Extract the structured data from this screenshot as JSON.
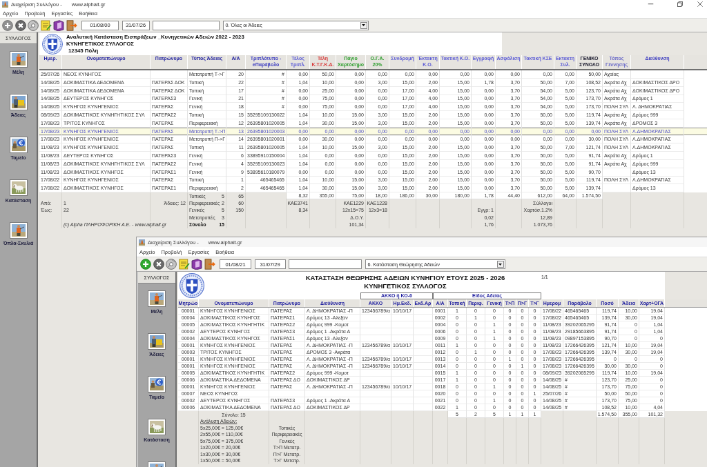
{
  "windows": [
    {
      "title": "Διαχείριση Συλλόγου -",
      "url": "www.alphait.gr",
      "menu": [
        "Αρχείο",
        "Προβολή",
        "Εργασίες",
        "Βοήθεια"
      ],
      "toolbar": {
        "buttons": [
          {
            "kind": "add",
            "disabled": true
          },
          {
            "kind": "delete",
            "disabled": true
          },
          {
            "kind": "disc",
            "disabled": false
          },
          {
            "kind": "notes",
            "disabled": false
          },
          {
            "kind": "book",
            "disabled": false
          },
          {
            "kind": "exit",
            "disabled": false
          }
        ],
        "date_from": "01/08/00",
        "date_to": "31/07/26",
        "report_choice": "0. Όλες οι Άδειες"
      },
      "sidebar": {
        "title": "ΣΥΛΛΟΓΟΣ",
        "items": [
          {
            "kind": "person",
            "label": "Μέλη"
          },
          {
            "kind": "bag",
            "label": "Άδειες"
          },
          {
            "kind": "euro",
            "label": "Ταμείο"
          },
          {
            "kind": "dog",
            "label": "Κατάσταση"
          },
          {
            "kind": "person",
            "label": "Όπλα-Σκυλιά"
          }
        ]
      },
      "report": {
        "kind": "income",
        "title": "Αναλυτική Κατάσταση Εισπράξεων _Κυνηγετικών Αδειών 2022 - 2023",
        "organization": "ΚΥΝΗΓΕΤΙΚΟΣ ΣΥΛΛΟΓΟΣ",
        "city": "12345 Πόλη",
        "columns": [
          {
            "label": "Ημερ.",
            "color": "#1f1f9f"
          },
          {
            "label": "Ονοματεπώνυμο",
            "color": "#1f1f9f"
          },
          {
            "label": "Πατρώνυμο",
            "color": "#1f1f9f"
          },
          {
            "label": "Τύπος Άδειας",
            "color": "#1f1f9f"
          },
          {
            "label": "Α/Α",
            "color": "#1f1f9f"
          },
          {
            "label": "Τριπλότυπο -\neΠαράβολο",
            "color": "#3c3cc0"
          },
          {
            "label": "Τέλος\nΤριπλ.",
            "color": "#5c5cd6"
          },
          {
            "label": "Τέλη\nΚ.Τ.Γ.Κ.Δ.",
            "color": "#d83c3c"
          },
          {
            "label": "Πάγιο\nΧαρτόσημο",
            "color": "#2e9e2e"
          },
          {
            "label": "Ο.Γ.Α.\n20%",
            "color": "#2e9e2e"
          },
          {
            "label": "Συνδρομή",
            "color": "#5c5cd6"
          },
          {
            "label": "Έκτακτη\nΚ.Ο.",
            "color": "#5c5cd6"
          },
          {
            "label": "Τακτική Κ.Ο.",
            "color": "#5c5cd6"
          },
          {
            "label": "Εγγραφή",
            "color": "#5c5cd6"
          },
          {
            "label": "Ασφάλιση",
            "color": "#5c5cd6"
          },
          {
            "label": "Τακτική ΚΣΕ",
            "color": "#5c5cd6"
          },
          {
            "label": "Εκτακτη\nΣυλ.",
            "color": "#5c5cd6"
          },
          {
            "label": "ΓΕΝΙΚΟ\nΣΥΝΟΛΟ",
            "color": "#141428"
          },
          {
            "label": "Τόπος\nΓέννησης",
            "color": "#6a6ac8"
          },
          {
            "label": "Διεύθυνση",
            "color": "#3c3cc0"
          }
        ],
        "rows": [
          {
            "selected": false,
            "cells": [
              "25/07/26",
              "ΝΕΟΣ ΚΥΝΗΓΟΣ",
              null,
              "Μετατροπή Τ->Γ",
              "20",
              "#",
              "0,00",
              "50,00",
              "0,00",
              "0,00",
              "0,00",
              "0,00",
              "0,00",
              "0,00",
              "0,00",
              "0,00",
              "0,00",
              "50,00",
              "Αχαίας",
              null
            ]
          },
          {
            "selected": false,
            "cells": [
              "14/08/25",
              "ΔΟΚΙΜΑΣΤΙΚΑ ΔΕΔΟΜΕΝΑ",
              "ΠΑΤΕΡΑΣ ΔΟΚ",
              "Τοπική",
              "22",
              "#",
              "1,04",
              "10,00",
              "0,00",
              "3,00",
              "15,00",
              "2,00",
              "15,00",
              "1,78",
              "3,70",
              "50,00",
              "7,00",
              "108,52",
              "Ακράτα Αχ",
              "ΔΟΚΙΜΑΣΤΙΚΟΣ ΔΡΟ"
            ]
          },
          {
            "selected": false,
            "cells": [
              "14/08/25",
              "ΔΟΚΙΜΑΣΤΙΚΑ ΔΕΔΟΜΕΝΑ",
              "ΠΑΤΕΡΑΣ ΔΟΚ",
              "Τοπική",
              "17",
              "#",
              "0,00",
              "25,00",
              "0,00",
              "0,00",
              "17,00",
              "4,00",
              "15,00",
              "0,00",
              "3,70",
              "54,00",
              "5,00",
              "123,70",
              "Ακράτα Αχ",
              "ΔΟΚΙΜΑΣΤΙΚΟΣ ΔΡΟ"
            ]
          },
          {
            "selected": false,
            "cells": [
              "14/08/25",
              "ΔΕΥΤΕΡΟΣ ΚΥΝΗΓΟΣ",
              "ΠΑΤΕΡΑΣ3",
              "Γενική",
              "21",
              "#",
              "0,00",
              "75,00",
              "0,00",
              "0,00",
              "17,00",
              "4,00",
              "15,00",
              "0,00",
              "3,70",
              "54,00",
              "5,00",
              "173,70",
              "Ακράτα Αχ",
              "Δρόμος 1"
            ]
          },
          {
            "selected": false,
            "cells": [
              "14/08/25",
              "ΚΥΝΗΓΟΣ ΚΥΝΗΓΕΝΙΟΣ",
              "ΠΑΤΕΡΑΣ",
              "Γενική",
              "18",
              "#",
              "0,00",
              "75,00",
              "0,00",
              "0,00",
              "17,00",
              "4,00",
              "15,00",
              "0,00",
              "3,70",
              "54,00",
              "5,00",
              "173,70",
              "ΠΟΛΗ ΣΥΛ",
              "Λ. ΔΗΜΟΚΡΑΤΙΑΣ"
            ]
          },
          {
            "selected": false,
            "cells": [
              "08/09/23",
              "ΔΟΚΙΜΑΣΤΙΚΟΣ ΚΥΝΗΓΗΤΙΚΟΣ ΣΥΛ",
              "ΠΑΤΕΡΑΣ2",
              "Τοπική",
              "15",
              "35295109130022",
              "1,04",
              "10,00",
              "15,00",
              "3,00",
              "15,00",
              "2,00",
              "15,00",
              "0,00",
              "3,70",
              "50,00",
              "5,00",
              "119,74",
              "Ακράτα Αχ",
              "Δρόμος 999"
            ]
          },
          {
            "selected": false,
            "cells": [
              "17/08/23",
              "ΤΡΙΤΟΣ ΚΥΝΗΓΟΣ",
              "ΠΑΤΕΡΑΣ",
              "Περιφερειακή",
              "12",
              "26395801020005",
              "1,04",
              "30,00",
              "15,00",
              "3,00",
              "15,00",
              "2,00",
              "15,00",
              "0,00",
              "3,70",
              "50,00",
              "5,00",
              "139,74",
              "Ακράτα Αχ",
              "ΔΡΟΜΟΣ 3"
            ]
          },
          {
            "selected": true,
            "cells": [
              "17/08/23",
              "ΚΥΝΗΓΟΣ ΚΥΝΗΓΕΝΙΟΣ",
              "ΠΑΤΕΡΑΣ",
              "Μετατροπή Τ->Π",
              "13",
              "26395801020003",
              "0,00",
              "0,00",
              "0,00",
              "0,00",
              "0,00",
              "0,00",
              "0,00",
              "0,00",
              "0,00",
              "0,00",
              "0,00",
              "0,00",
              "ΠΟΛΗ ΣΥΛ",
              "Λ.ΔΗΜΟΚΡΑΤΙΑΣ"
            ]
          },
          {
            "selected": false,
            "cells": [
              "17/08/23",
              "ΚΥΝΗΓΟΣ ΚΥΝΗΓΕΝΙΟΣ",
              "ΠΑΤΕΡΑΣ",
              "Μετατροπή Π->Γ",
              "14",
              "26395801020001",
              "0,00",
              "30,00",
              "0,00",
              "0,00",
              "0,00",
              "0,00",
              "0,00",
              "0,00",
              "0,00",
              "0,00",
              "0,00",
              "30,00",
              "ΠΟΛΗ ΣΥΛ",
              "Λ.ΔΗΜΟΚΡΑΤΙΑΣ"
            ]
          },
          {
            "selected": false,
            "cells": [
              "11/08/23",
              "ΚΥΝΗΓΟΣ ΚΥΝΗΓΕΝΙΟΣ",
              "ΠΑΤΕΡΑΣ",
              "Τοπική",
              "11",
              "26395801020005",
              "1,04",
              "10,00",
              "15,00",
              "3,00",
              "15,00",
              "2,00",
              "15,00",
              "0,00",
              "3,70",
              "50,00",
              "7,00",
              "121,74",
              "ΠΟΛΗ ΣΥΛ",
              "Λ.ΔΗΜΟΚΡΑΤΙΑΣ"
            ]
          },
          {
            "selected": false,
            "cells": [
              "11/08/23",
              "ΔΕΥΤΕΡΟΣ ΚΥΝΗΓΟΣ",
              "ΠΑΤΕΡΑΣ3",
              "Γενική",
              "6",
              "33895910150004",
              "1,04",
              "0,00",
              "0,00",
              "0,00",
              "15,00",
              "2,00",
              "15,00",
              "0,00",
              "3,70",
              "50,00",
              "5,00",
              "91,74",
              "Ακράτα Αχ",
              "Δρόμος 1"
            ]
          },
          {
            "selected": false,
            "cells": [
              "11/08/23",
              "ΔΟΚΙΜΑΣΤΙΚΟΣ ΚΥΝΗΓΗΤΙΚΟΣ ΣΥΛ",
              "ΠΑΤΕΡΑΣ2",
              "Γενική",
              "4",
              "35295109130023",
              "1,04",
              "0,00",
              "0,00",
              "0,00",
              "15,00",
              "2,00",
              "15,00",
              "0,00",
              "3,70",
              "50,00",
              "5,00",
              "91,74",
              "Ακράτα Αχ",
              "Δρόμος 999"
            ]
          },
          {
            "selected": false,
            "cells": [
              "11/08/23",
              "ΔΟΚΙΜΑΣΤΙΚΟΣ ΚΥΝΗΓΟΣ",
              "ΠΑΤΕΡΑΣ1",
              "Γενική",
              "9",
              "53895610180079",
              "0,00",
              "0,00",
              "0,00",
              "0,00",
              "15,00",
              "2,00",
              "15,00",
              "0,00",
              "3,70",
              "50,00",
              "5,00",
              "90,70",
              null,
              "Δρόμος 13"
            ]
          },
          {
            "selected": false,
            "cells": [
              "17/08/22",
              "ΚΥΝΗΓΟΣ ΚΥΝΗΓΕΝΙΟΣ",
              "ΠΑΤΕΡΑΣ",
              "Τοπική",
              "1",
              "465465465",
              "1,04",
              "10,00",
              "15,00",
              "3,00",
              "15,00",
              "2,00",
              "15,00",
              "0,00",
              "3,70",
              "50,00",
              "5,00",
              "119,74",
              "ΠΟΛΗ ΣΥΛ",
              "Λ.ΔΗΜΟΚΡΑΤΙΑΣ"
            ]
          },
          {
            "selected": false,
            "cells": [
              "17/08/22",
              "ΔΟΚΙΜΑΣΤΙΚΟΣ ΚΥΝΗΓΟΣ",
              "ΠΑΤΕΡΑΣ1",
              "Περιφερειακή",
              "2",
              "465465465",
              "1,04",
              "30,00",
              "15,00",
              "3,00",
              "15,00",
              "2,00",
              "15,00",
              "0,00",
              "3,70",
              "50,00",
              "5,00",
              "139,74",
              null,
              "Δρόμος 13"
            ]
          }
        ],
        "totals": {
          "cells": [
            null,
            null,
            null,
            null,
            null,
            null,
            "8,32",
            "355,00",
            "75,00",
            "18,00",
            "186,00",
            "30,00",
            "180,00",
            "1,78",
            "44,40",
            "612,00",
            "64,00",
            "1.574,50",
            null,
            null
          ]
        },
        "footer_columns": [
          [
            null,
            "Από:",
            "Έως:"
          ],
          [
            null,
            "1",
            "22"
          ],
          [
            null,
            "Άδειες: 12"
          ],
          [
            {
              "label": "Τοπικές",
              "value": "5",
              "kind": "count"
            },
            {
              "label": "Περιφερειακές",
              "value": "2",
              "kind": "count"
            },
            {
              "label": "Γενικές",
              "value": "5",
              "kind": "count"
            },
            {
              "label": "Μετατροπές",
              "value": "3",
              "kind": "count"
            },
            {
              "label": "Σύνολο",
              "value": "15",
              "kind": "total"
            }
          ],
          [
            "65",
            "60",
            "150"
          ],
          null,
          [
            null,
            "ΚΑΕ3741",
            "8,34"
          ],
          null,
          [
            null,
            "ΚΑΕ1229",
            "12x15=75",
            "Δ.Ο.Υ.",
            "101,34"
          ],
          [
            null,
            "ΚΑΕ1228",
            "12x3=18"
          ],
          null,
          null,
          null,
          [
            null,
            null,
            "Εγγρ: 1",
            "0,02",
            "1,76"
          ],
          null,
          [
            null,
            "Σύλλογοι",
            "Χαρτόσ.1.2%",
            "12,89",
            "1.073,76"
          ],
          null,
          null,
          null,
          null
        ],
        "copyright": "(c) Alpha ΠΛΗΡΟΦΟΡΙΚΗ Α.Ε. - www.alphait.gr"
      }
    },
    {
      "title": "Διαχείριση Συλλόγου -",
      "url": "www.alphait.gr",
      "menu": [
        "Αρχείο",
        "Προβολή",
        "Εργασίες",
        "Βοήθεια"
      ],
      "toolbar": {
        "buttons": [
          {
            "kind": "add",
            "disabled": false
          },
          {
            "kind": "delete",
            "disabled": true
          },
          {
            "kind": "disc",
            "disabled": false
          },
          {
            "kind": "notes",
            "disabled": false
          },
          {
            "kind": "book",
            "disabled": false
          },
          {
            "kind": "exit",
            "disabled": false
          }
        ],
        "date_from": "01/08/21",
        "date_to": "31/07/29",
        "report_choice": "6. Κατάσταση Θεώρησης Αδειών"
      },
      "sidebar": {
        "title": "ΣΥΛΛΟΓΟΣ",
        "items": [
          {
            "kind": "person",
            "label": "Μέλη"
          },
          {
            "kind": "bag",
            "label": "Άδειες"
          },
          {
            "kind": "euro",
            "label": "Ταμείο"
          },
          {
            "kind": "dog",
            "label": "Κατάσταση"
          },
          {
            "kind": "person"
          }
        ]
      },
      "report": {
        "kind": "renewal",
        "title": "ΚΑΤΑΣΤΑΣΗ ΘΕΩΡΗΣΗΣ ΑΔΕΙΩΝ ΚΥΝΗΓΙΟΥ ΕΤΟΥΣ 2025 - 2026",
        "organization": "ΚΥΝΗΓΕΤΙΚΟΣ ΣΥΛΛΟΓΟΣ",
        "page": "1/1",
        "groups": [
          "ΑΚΚΟ ή ΚΟ-6",
          "Είδος Αδείας"
        ],
        "columns": [
          "Μητρώο",
          "Ονοματεπώνυμο",
          "Πατρώνυμο",
          "Διεύθυνση",
          "ΑΚΚΟ",
          "Ημ.Εκδ.",
          "Εκδ.Αρ",
          "Α/Α",
          "Τοπική",
          "Περιφ.",
          "Γενική",
          "Τ>Π",
          "Π>Γ",
          "Τ>Γ",
          "Ημερομ",
          "Παράβολο",
          "Ποσό",
          "Άδεια",
          "Χαρτ+ΟΓΑ"
        ],
        "rows": [
          [
            "00001",
            "ΚΥΝΗΓΟΣ ΚΥΝΗΓΕΝΙΟΣ",
            "ΠΑΤΕΡΑΣ",
            "Λ. ΔΗΜΟΚΡΑΤΙΑΣ -Π",
            "123456789/α",
            "10/10/17",
            null,
            "0001",
            "1",
            "0",
            "0",
            "0",
            "0",
            "0",
            "17/08/22",
            "465465465",
            "119,74",
            "10,00",
            "19,04"
          ],
          [
            "00004",
            "ΔΟΚΙΜΑΣΤΙΚΟΣ ΚΥΝΗΓΟΣ",
            "ΠΑΤΕΡΑΣ1",
            "Δρόμος 13 -Αλεξαν",
            null,
            null,
            null,
            "0002",
            "0",
            "1",
            "0",
            "0",
            "0",
            "0",
            "17/08/22",
            "465465465",
            "139,74",
            "30,00",
            "19,04"
          ],
          [
            "00005",
            "ΔΟΚΙΜΑΣΤΙΚΟΣ ΚΥΝΗΓΗΤΙΚ",
            "ΠΑΤΕΡΑΣ2",
            "Δρόμος 999 -Κομοτ",
            null,
            null,
            null,
            "0004",
            "0",
            "0",
            "1",
            "0",
            "0",
            "0",
            "11/08/23",
            "39202065295",
            "91,74",
            "0",
            "1,04"
          ],
          [
            "00002",
            "ΔΕΥΤΕΡΟΣ ΚΥΝΗΓΟΣ",
            "ΠΑΤΕΡΑΣ3",
            "Δρόμος 1 -Ακράτα Α",
            null,
            null,
            null,
            "0006",
            "0",
            "0",
            "1",
            "0",
            "0",
            "0",
            "11/08/23",
            "29185663895",
            "91,74",
            "0",
            "1,04"
          ],
          [
            "00004",
            "ΔΟΚΙΜΑΣΤΙΚΟΣ ΚΥΝΗΓΟΣ",
            "ΠΑΤΕΡΑΣ1",
            "Δρόμος 13 -Αλεξαν",
            null,
            null,
            null,
            "0009",
            "0",
            "0",
            "1",
            "0",
            "0",
            "0",
            "11/08/23",
            "09897153895",
            "90,70",
            "0",
            "0"
          ],
          [
            "00001",
            "ΚΥΝΗΓΟΣ ΚΥΝΗΓΕΝΙΟΣ",
            "ΠΑΤΕΡΑΣ",
            "Λ. ΔΗΜΟΚΡΑΤΙΑΣ -Π",
            "123456789/α",
            "10/10/17",
            null,
            "0011",
            "1",
            "0",
            "0",
            "0",
            "0",
            "0",
            "11/08/23",
            "17266426395",
            "121,74",
            "10,00",
            "19,04"
          ],
          [
            "00003",
            "ΤΡΙΤΟΣ ΚΥΝΗΓΟΣ",
            "ΠΑΤΕΡΑΣ",
            "ΔΡΟΜΟΣ 3 -Ακράτα",
            null,
            null,
            null,
            "0012",
            "0",
            "1",
            "0",
            "0",
            "0",
            "0",
            "17/08/23",
            "17266426395",
            "139,74",
            "30,00",
            "19,04"
          ],
          [
            "00001",
            "ΚΥΝΗΓΟΣ ΚΥΝΗΓΕΝΙΟΣ",
            "ΠΑΤΕΡΑΣ",
            "Λ. ΔΗΜΟΚΡΑΤΙΑΣ -Π",
            "123456789/α",
            "10/10/17",
            null,
            "0013",
            "0",
            "0",
            "0",
            "1",
            "0",
            "0",
            "17/08/23",
            "17266426395",
            "0",
            "0",
            "0"
          ],
          [
            "00001",
            "ΚΥΝΗΓΟΣ ΚΥΝΗΓΕΝΙΟΣ",
            "ΠΑΤΕΡΑΣ",
            "Λ. ΔΗΜΟΚΡΑΤΙΑΣ -Π",
            "123456789/α",
            "10/10/17",
            null,
            "0014",
            "0",
            "0",
            "0",
            "0",
            "1",
            "0",
            "17/08/23",
            "17266426395",
            "30,00",
            "30,00",
            "0"
          ],
          [
            "00005",
            "ΔΟΚΙΜΑΣΤΙΚΟΣ ΚΥΝΗΓΗΤΙΚ",
            "ΠΑΤΕΡΑΣ2",
            "Δρόμος 999 -Κομοτ",
            null,
            null,
            null,
            "0015",
            "1",
            "0",
            "0",
            "0",
            "0",
            "0",
            "08/09/23",
            "39202065295",
            "119,74",
            "10,00",
            "19,04"
          ],
          [
            "00006",
            "ΔΟΚΙΜΑΣΤΙΚΑ ΔΕΔΟΜΕΝΑ",
            "ΠΑΤΕΡΑΣ ΔΟ",
            "ΔΟΚΙΜΑΣΤΙΚΟΣ ΔΡ",
            null,
            null,
            null,
            "0017",
            "1",
            "0",
            "0",
            "0",
            "0",
            "0",
            "14/08/25",
            "#",
            "123,70",
            "25,00",
            "0"
          ],
          [
            "00001",
            "ΚΥΝΗΓΟΣ ΚΥΝΗΓΕΝΙΟΣ",
            "ΠΑΤΕΡΑΣ",
            "Λ. ΔΗΜΟΚΡΑΤΙΑΣ -Π",
            "123456789/α",
            "10/10/17",
            null,
            "0018",
            "0",
            "0",
            "1",
            "0",
            "0",
            "0",
            "14/08/25",
            "#",
            "173,70",
            "75,00",
            "0"
          ],
          [
            "00007",
            "ΝΕΟΣ ΚΥΝΗΓΟΣ",
            null,
            null,
            null,
            null,
            null,
            "0020",
            "0",
            "0",
            "0",
            "0",
            "0",
            "1",
            "25/07/26",
            "#",
            "50,00",
            "50,00",
            "0"
          ],
          [
            "00002",
            "ΔΕΥΤΕΡΟΣ ΚΥΝΗΓΟΣ",
            "ΠΑΤΕΡΑΣ3",
            "Δρόμος 1 -Ακράτα Α",
            null,
            null,
            null,
            "0021",
            "0",
            "0",
            "1",
            "0",
            "0",
            "0",
            "14/08/25",
            "#",
            "173,70",
            "75,00",
            "0"
          ],
          [
            "00006",
            "ΔΟΚΙΜΑΣΤΙΚΑ ΔΕΔΟΜΕΝΑ",
            "ΠΑΤΕΡΑΣ ΔΟ",
            "ΔΟΚΙΜΑΣΤΙΚΟΣ ΔΡ",
            null,
            null,
            null,
            "0022",
            "1",
            "0",
            "0",
            "0",
            "0",
            "0",
            "14/08/25",
            "#",
            "108,52",
            "10,00",
            "4,04"
          ]
        ],
        "totals": {
          "cells": [
            null,
            null,
            null,
            null,
            null,
            null,
            null,
            null,
            "5",
            "2",
            "5",
            "1",
            "1",
            "1",
            null,
            null,
            "1.574,50",
            "355,00",
            "101,32"
          ]
        },
        "count": "Σύνολο: 15",
        "analysis": {
          "title": "Ανάλυση Αδειών:",
          "lines": [
            {
              "formula": "5x25,00€ = 125,00€",
              "type": "Τοπικές"
            },
            {
              "formula": "2x55,00€ = 110,00€",
              "type": "Περιφερειακές"
            },
            {
              "formula": "5x75,00€ = 375,00€",
              "type": "Γενικές"
            },
            {
              "formula": "1x20,00€ = 20,00€",
              "type": "Τ>Π Μετατρ."
            },
            {
              "formula": "1x30,00€ = 30,00€",
              "type": "Π>Γ Μετατρ."
            },
            {
              "formula": "1x50,00€ = 50,00€",
              "type": "Τ>Γ Μετατρ."
            }
          ]
        }
      }
    }
  ]
}
